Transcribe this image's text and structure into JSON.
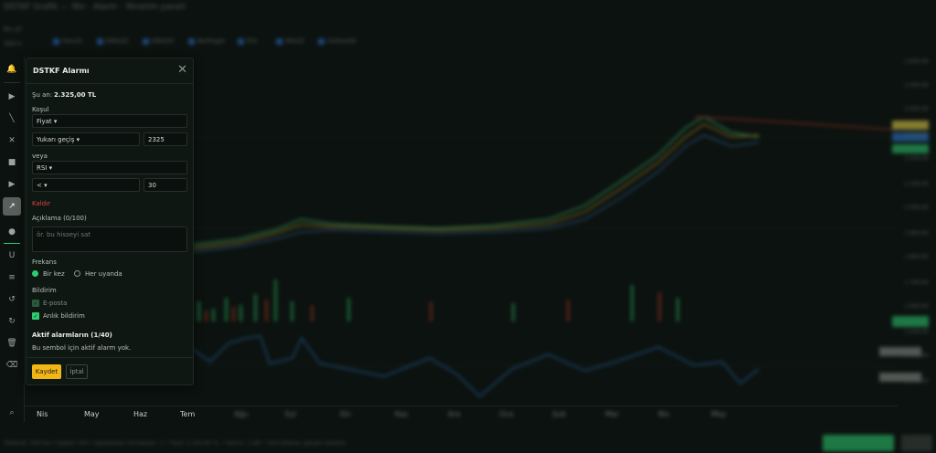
{
  "window": {
    "title": "DSTKF Grafik — Yön · Alarm · Yönetim paneli"
  },
  "sidebar_top": {
    "period_label": "Bu yıl",
    "range_select": "300 ▾"
  },
  "indicators": [
    {
      "label": "Hacim"
    },
    {
      "label": "EMA20"
    },
    {
      "label": "EMA50"
    },
    {
      "label": "Bollinger"
    },
    {
      "label": "RSI"
    },
    {
      "label": "MACD"
    },
    {
      "label": "Stokastik"
    }
  ],
  "price_axis": {
    "labels": [
      "2.600,00",
      "2.500,00",
      "2.400,00",
      "2.300,00",
      "2.200,00",
      "2.100,00",
      "2.000,00",
      "1.900,00",
      "1.800,00",
      "1.700,00",
      "1.600,00",
      "1.500,00",
      "1.400,00",
      "1.300,00"
    ]
  },
  "months": [
    "Nis",
    "May",
    "Haz",
    "Tem",
    "Ağu",
    "Eyl",
    "Eki",
    "Kas",
    "Ara",
    "Oca",
    "Şub",
    "Mar",
    "Nis",
    "May"
  ],
  "status_bar": {
    "text": "Yüklendi: 300 bar / toplam 330 • İşaretlenen formasyon: 1 • Fiyat: 2.325,00 TL • Hacim: 1,2M • Güncelleme: gerçek zamanlı"
  },
  "colors": {
    "accent": "#f2b616",
    "positive": "#2ecc71",
    "negative": "#e0453b",
    "panel": "#0f1713"
  },
  "alarm_modal": {
    "title": "DSTKF Alarmı",
    "current_price_label": "Şu an:",
    "current_price_value": "2.325,00 TL",
    "condition_label": "Koşul",
    "condition_type": "Fiyat",
    "condition_operator": "Yukarı geçiş",
    "condition_value": "2325",
    "or_label": "veya",
    "or_type": "RSI",
    "or_operator": "<",
    "or_value": "30",
    "remove_label": "Kaldır",
    "description_label": "Açıklama (0/100)",
    "description_placeholder": "ör. bu hisseyi sat",
    "frequency_label": "Frekans",
    "frequency_options": [
      "Bir kez",
      "Her uyanda"
    ],
    "frequency_selected": "Bir kez",
    "notification_label": "Bildirim",
    "notifications": [
      {
        "label": "E-posta",
        "checked": true
      },
      {
        "label": "Anlık bildirim",
        "checked": true
      }
    ],
    "active_alarms_label": "Aktif alarmların (1/40)",
    "active_alarms_text": "Bu sembol için aktif alarm yok.",
    "save_label": "Kaydet",
    "cancel_label": "İptal"
  }
}
